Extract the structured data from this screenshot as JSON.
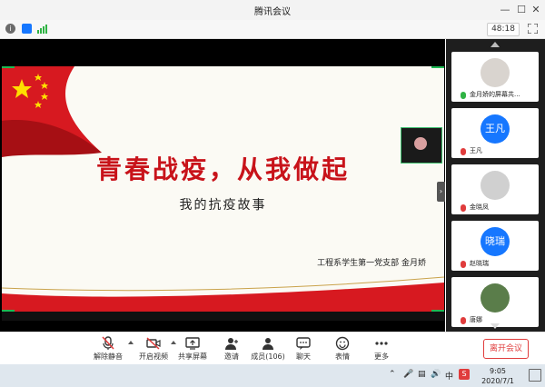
{
  "window": {
    "title": "腾讯会议"
  },
  "infobar": {
    "timer": "48:18"
  },
  "slide": {
    "title": "青春战疫，从我做起",
    "subtitle": "我的抗疫故事",
    "author": "工程系学生第一党支部  金月娇"
  },
  "participants": [
    {
      "name": "金月娇的屏幕共...",
      "avatar_text": "",
      "avatar_color": "#d9d4cf",
      "mic": "on"
    },
    {
      "name": "王凡",
      "avatar_text": "王凡",
      "avatar_color": "#1677ff",
      "mic": "off"
    },
    {
      "name": "金晓凤",
      "avatar_text": "",
      "avatar_color": "#d0d0d0",
      "mic": "off"
    },
    {
      "name": "赵晓瑞",
      "avatar_text": "晓瑞",
      "avatar_color": "#1677ff",
      "mic": "off"
    },
    {
      "name": "唐娜",
      "avatar_text": "",
      "avatar_color": "#5a7d4a",
      "mic": "off"
    }
  ],
  "controls": {
    "mute": "解除静音",
    "video": "开启视频",
    "share": "共享屏幕",
    "invite": "邀请",
    "members": "成员(106)",
    "chat": "聊天",
    "emoji": "表情",
    "more": "更多",
    "end": "离开会议"
  },
  "taskbar": {
    "ime": "中",
    "time": "9:05",
    "date": "2020/7/1"
  },
  "colors": {
    "accent": "#1677ff",
    "danger": "#e03c3c",
    "slide_red": "#c8131a"
  }
}
